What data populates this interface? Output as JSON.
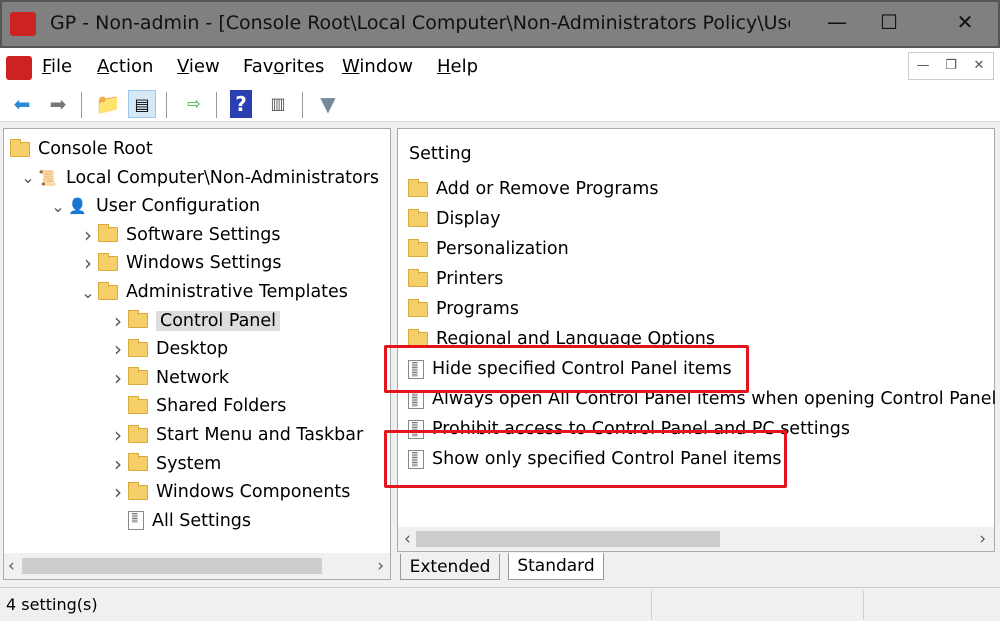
{
  "window": {
    "title": "GP - Non-admin - [Console Root\\Local Computer\\Non-Administrators Policy\\User C...",
    "minimize": "—",
    "maximize": "☐",
    "close": "✕"
  },
  "menu": [
    "File",
    "Action",
    "View",
    "Favorites",
    "Window",
    "Help"
  ],
  "menu_accel": [
    "F",
    "A",
    "V",
    "o",
    "W",
    "H"
  ],
  "toolbar_icons": [
    "back-arrow-icon",
    "forward-arrow-icon",
    "up-folder-icon",
    "show-hide-tree-icon",
    "export-list-icon",
    "help-icon",
    "show-action-pane-icon",
    "filter-icon"
  ],
  "tree": [
    {
      "label": "Console Root",
      "level": 0,
      "icon": "folder",
      "chev": ""
    },
    {
      "label": "Local Computer\\Non-Administrators",
      "level": 1,
      "icon": "policy",
      "chev": "v"
    },
    {
      "label": "User Configuration",
      "level": 2,
      "icon": "user",
      "chev": "v"
    },
    {
      "label": "Software Settings",
      "level": 3,
      "icon": "folder",
      "chev": ">"
    },
    {
      "label": "Windows Settings",
      "level": 3,
      "icon": "folder",
      "chev": ">"
    },
    {
      "label": "Administrative Templates",
      "level": 3,
      "icon": "folder",
      "chev": "v"
    },
    {
      "label": "Control Panel",
      "level": 4,
      "icon": "folder",
      "chev": ">",
      "selected": true
    },
    {
      "label": "Desktop",
      "level": 4,
      "icon": "folder",
      "chev": ">"
    },
    {
      "label": "Network",
      "level": 4,
      "icon": "folder",
      "chev": ">"
    },
    {
      "label": "Shared Folders",
      "level": 4,
      "icon": "folder",
      "chev": ""
    },
    {
      "label": "Start Menu and Taskbar",
      "level": 4,
      "icon": "folder",
      "chev": ">"
    },
    {
      "label": "System",
      "level": 4,
      "icon": "folder",
      "chev": ">"
    },
    {
      "label": "Windows Components",
      "level": 4,
      "icon": "folder",
      "chev": ">"
    },
    {
      "label": "All Settings",
      "level": 4,
      "icon": "settings",
      "chev": ""
    }
  ],
  "list": {
    "header": "Setting",
    "items": [
      {
        "label": "Add or Remove Programs",
        "icon": "folder"
      },
      {
        "label": "Display",
        "icon": "folder"
      },
      {
        "label": "Personalization",
        "icon": "folder"
      },
      {
        "label": "Printers",
        "icon": "folder"
      },
      {
        "label": "Programs",
        "icon": "folder"
      },
      {
        "label": "Regional and Language Options",
        "icon": "folder"
      },
      {
        "label": "Hide specified Control Panel items",
        "icon": "setting",
        "highlighted": true
      },
      {
        "label": "Always open All Control Panel items when opening Control Panel",
        "icon": "setting"
      },
      {
        "label": "Prohibit access to Control Panel and PC settings",
        "icon": "setting"
      },
      {
        "label": "Show only specified Control Panel items",
        "icon": "setting",
        "highlighted": true
      }
    ]
  },
  "tabs": {
    "extended": "Extended",
    "standard": "Standard",
    "active": "Standard"
  },
  "status": "4 setting(s)",
  "colors": {
    "highlight_box": "#e3141b",
    "titlebar": "#808080"
  }
}
